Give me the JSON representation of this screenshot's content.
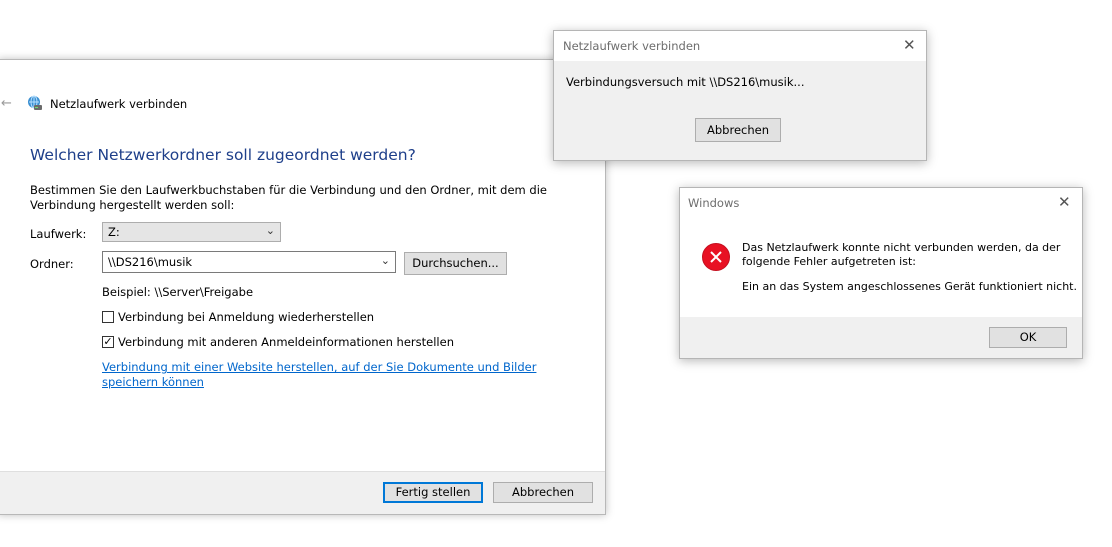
{
  "wizard": {
    "title": "Netzlaufwerk verbinden",
    "heading": "Welcher Netzwerkordner soll zugeordnet werden?",
    "description": "Bestimmen Sie den Laufwerkbuchstaben für die Verbindung und den Ordner, mit dem die Verbindung hergestellt werden soll:",
    "drive_label": "Laufwerk:",
    "drive_value": "Z:",
    "folder_label": "Ordner:",
    "folder_value": "\\\\DS216\\musik",
    "browse_label": "Durchsuchen...",
    "example": "Beispiel: \\\\Server\\Freigabe",
    "reconnect_label": "Verbindung bei Anmeldung wiederherstellen",
    "reconnect_checked": false,
    "other_credentials_label": "Verbindung mit anderen Anmeldeinformationen herstellen",
    "other_credentials_checked": true,
    "website_link": "Verbindung mit einer Website herstellen, auf der Sie Dokumente und Bilder speichern können",
    "finish_label": "Fertig stellen",
    "cancel_label": "Abbrechen"
  },
  "progress_dialog": {
    "title": "Netzlaufwerk verbinden",
    "message": "Verbindungsversuch mit \\\\DS216\\musik...",
    "cancel_label": "Abbrechen"
  },
  "error_dialog": {
    "title": "Windows",
    "message_line1": "Das Netzlaufwerk konnte nicht verbunden werden, da der",
    "message_line2": "folgende Fehler aufgetreten ist:",
    "detail": "Ein an das System angeschlossenes Gerät funktioniert nicht.",
    "ok_label": "OK"
  },
  "icons": {
    "back": "back-arrow-icon",
    "network_drive": "network-drive-icon",
    "close": "close-icon",
    "error": "error-icon",
    "chevron": "chevron-down-icon"
  },
  "colors": {
    "heading": "#1e3f8a",
    "link": "#0066cc",
    "error": "#e81123",
    "default_button_border": "#0078d7"
  }
}
